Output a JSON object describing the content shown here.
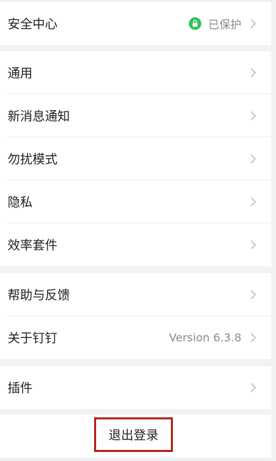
{
  "security": {
    "label": "安全中心",
    "status": "已保护",
    "status_icon": "lock-icon",
    "status_color": "#2fbf5b"
  },
  "group_general": [
    {
      "label": "通用"
    },
    {
      "label": "新消息通知"
    },
    {
      "label": "勿扰模式"
    },
    {
      "label": "隐私"
    },
    {
      "label": "效率套件"
    }
  ],
  "group_support": [
    {
      "label": "帮助与反馈",
      "value": ""
    },
    {
      "label": "关于钉钉",
      "value": "Version 6.3.8"
    }
  ],
  "plugins": {
    "label": "插件"
  },
  "logout": {
    "label": "退出登录",
    "highlight_color": "#b3261e"
  },
  "icons": {
    "chevron": "chevron-right-icon"
  }
}
